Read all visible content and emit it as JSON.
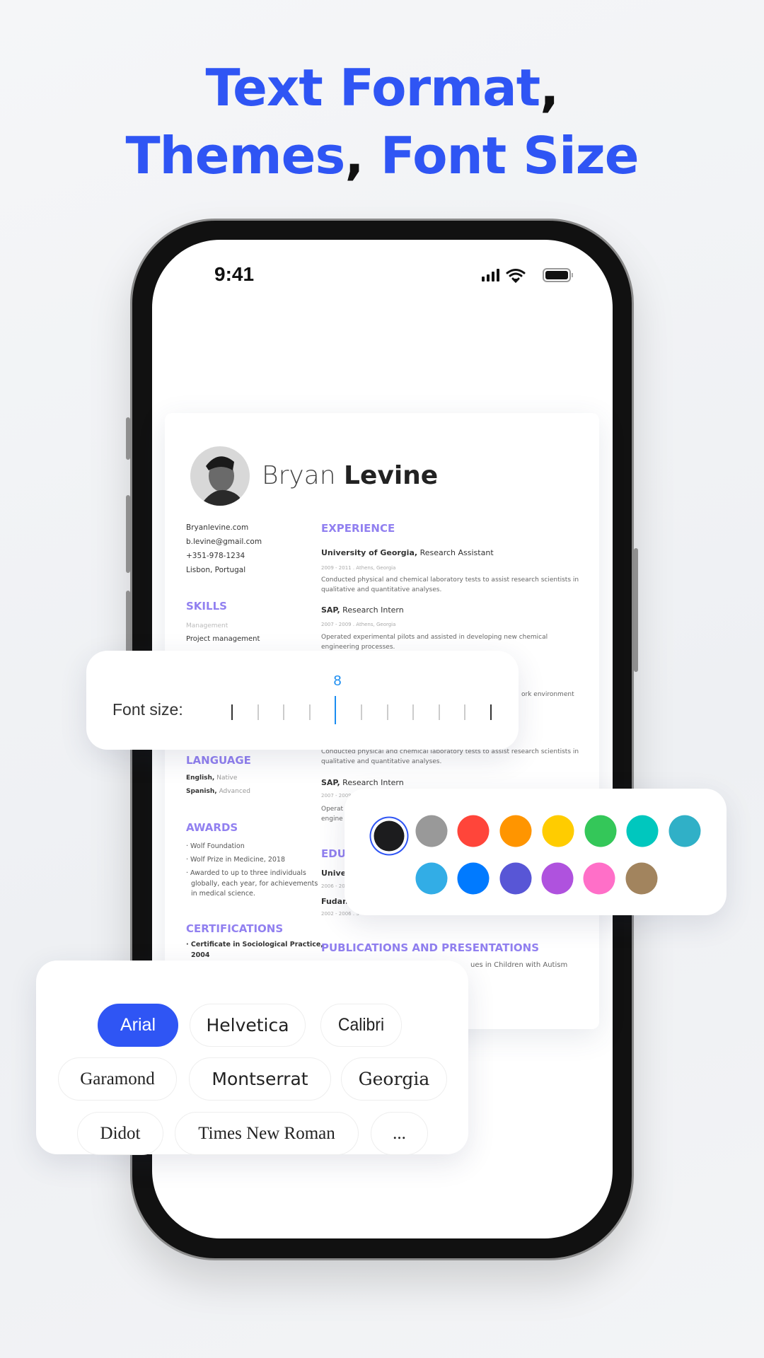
{
  "headline": {
    "line1": "Text Format",
    "line2a": "Themes",
    "line2b": "Font Size",
    "comma": ","
  },
  "status_bar": {
    "time": "9:41"
  },
  "resume": {
    "first_name": "Bryan",
    "last_name": "Levine",
    "contact": [
      "Bryanlevine.com",
      "b.levine@gmail.com",
      "+351-978-1234",
      "Lisbon, Portugal"
    ],
    "skills": {
      "title": "SKILLS",
      "category": "Management",
      "item": "Project management"
    },
    "language": {
      "title": "LANGUAGE",
      "items": [
        {
          "name": "English,",
          "level": "Native"
        },
        {
          "name": "Spanish,",
          "level": "Advanced"
        }
      ]
    },
    "awards": {
      "title": "AWARDS",
      "items": [
        "Wolf Foundation",
        "Wolf Prize in Medicine, 2018",
        "Awarded to up to three individuals",
        "globally, each year, for achievements",
        "in medical science."
      ]
    },
    "certifications": {
      "title": "CERTIFICATIONS",
      "item": "Certificate in Sociological Practice,",
      "year": "2004"
    },
    "experience": {
      "title": "EXPERIENCE",
      "jobs": [
        {
          "org": "University of Georgia,",
          "role": "Research Assistant",
          "date": "2009 - 2011 . Athens, Georgia",
          "desc": [
            "Conducted physical and chemical laboratory tests to assist research scientists in",
            "qualitative and quantitative analyses."
          ]
        },
        {
          "org": "SAP,",
          "role": "Research Intern",
          "date": "2007 - 2009 . Athens, Georgia",
          "desc": [
            "Operated experimental pilots and assisted in developing new chemical",
            "engineering processes."
          ]
        }
      ],
      "partial": "ork environment",
      "desc2": [
        "Conducted physical and chemical laboratory tests to assist research scientists in",
        "qualitative and quantitative analyses."
      ],
      "job3": {
        "org": "SAP,",
        "role": "Research Intern",
        "date": "2007 - 2009",
        "desc": [
          "Operat",
          "engine"
        ]
      }
    },
    "education": {
      "title": "EDU",
      "items": [
        {
          "org": "Unive",
          "date": "2006 - 20"
        },
        {
          "org": "Fudan",
          "date": "2002 - 2006 . S"
        }
      ]
    },
    "publications": {
      "title": "PUBLICATIONS AND PRESENTATIONS",
      "partial": "ues in Children with Autism"
    }
  },
  "font_size": {
    "label": "Font size:",
    "value": "8",
    "selected_index": 4,
    "tick_count": 11,
    "accent": "#1a8cf0"
  },
  "colors": {
    "selected": "#1c1c1e",
    "ring": "#2f55f4",
    "row1": [
      "#1c1c1e",
      "#999999",
      "#ff453a",
      "#ff9500",
      "#ffcc00",
      "#34c759",
      "#00c7be",
      "#30b0c7"
    ],
    "row2": [
      "#32ade6",
      "#007aff",
      "#5856d6",
      "#af52de",
      "#ff6fc8",
      "#a2845e"
    ]
  },
  "fonts": {
    "selected": "Arial",
    "accent": "#2f55f4",
    "items": [
      "Arial",
      "Helvetica",
      "Calibri",
      "Garamond",
      "Montserrat",
      "Georgia",
      "Didot",
      "Times New Roman",
      "..."
    ]
  }
}
